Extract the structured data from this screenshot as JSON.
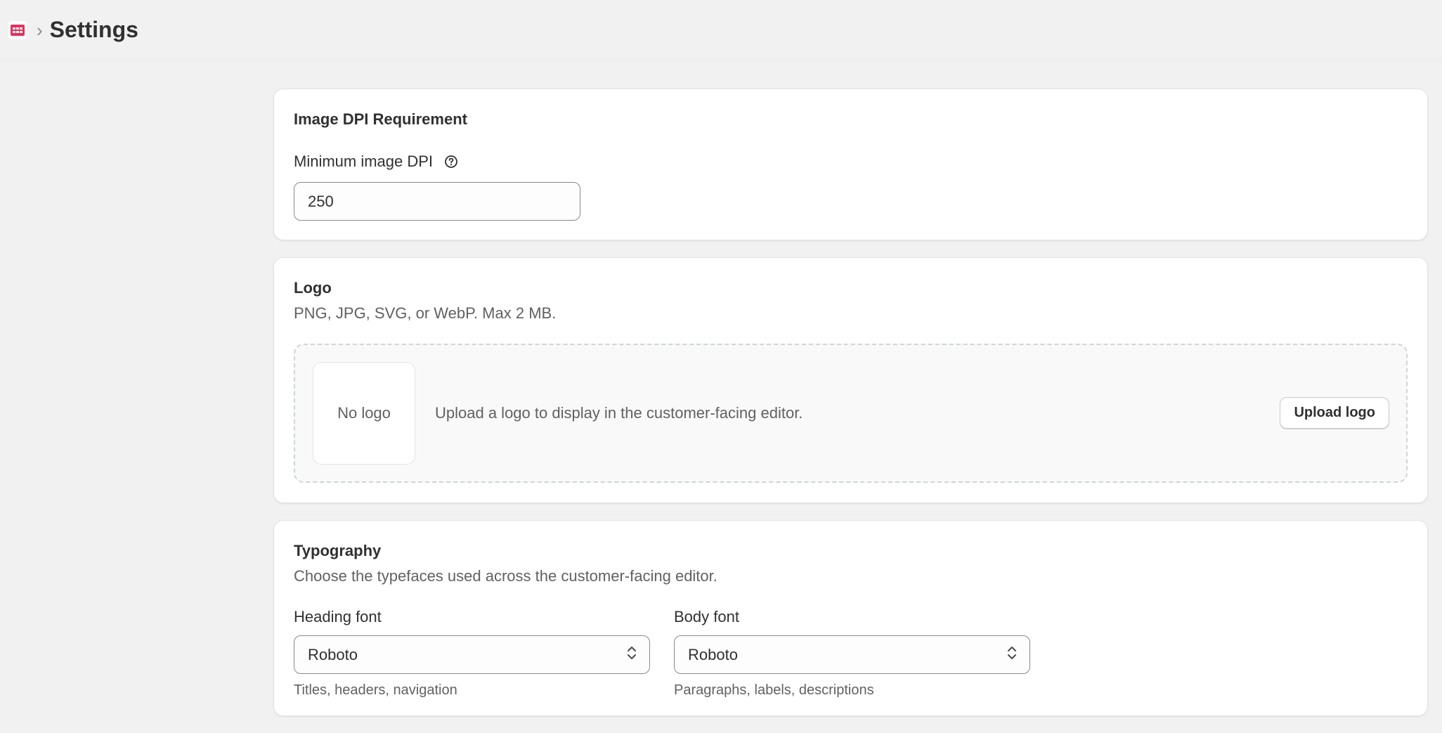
{
  "header": {
    "icon": "app-grid-icon",
    "breadcrumb_separator": "›",
    "title": "Settings"
  },
  "dpi_card": {
    "title": "Image DPI Requirement",
    "field_label": "Minimum image DPI",
    "help_icon": "question-circle-icon",
    "value": "250"
  },
  "logo_card": {
    "title": "Logo",
    "subtitle": "PNG, JPG, SVG, or WebP. Max 2 MB.",
    "placeholder_text": "No logo",
    "drop_text": "Upload a logo to display in the customer-facing editor.",
    "upload_button": "Upload logo"
  },
  "typography_card": {
    "title": "Typography",
    "subtitle": "Choose the typefaces used across the customer-facing editor.",
    "heading_font": {
      "label": "Heading font",
      "value": "Roboto",
      "hint": "Titles, headers, navigation"
    },
    "body_font": {
      "label": "Body font",
      "value": "Roboto",
      "hint": "Paragraphs, labels, descriptions"
    }
  },
  "colors": {
    "background": "#f1f1f1",
    "card": "#ffffff",
    "text": "#303030",
    "muted_text": "#616161",
    "brand_icon": "#e0335a"
  }
}
